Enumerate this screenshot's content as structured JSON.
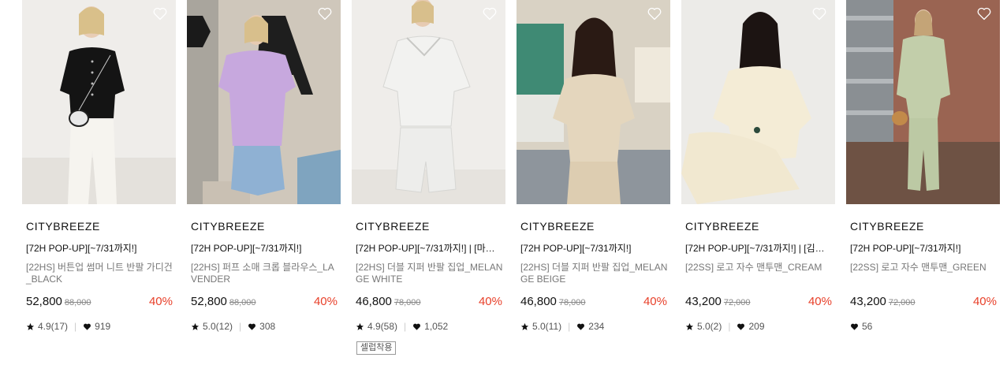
{
  "products": [
    {
      "brand": "CITYBREEZE",
      "promo": "[72H POP-UP][~7/31까지!]",
      "name": "[22HS] 버튼업 썸머 니트 반팔 가디건_BLACK",
      "price": "52,800",
      "original_price": "88,000",
      "discount": "40%",
      "rating": "4.9(17)",
      "likes": "919",
      "tag": ""
    },
    {
      "brand": "CITYBREEZE",
      "promo": "[72H POP-UP][~7/31까지!]",
      "name": "[22HS] 퍼프 소매 크롭 블라우스_LAVENDER",
      "price": "52,800",
      "original_price": "88,000",
      "discount": "40%",
      "rating": "5.0(12)",
      "likes": "308",
      "tag": ""
    },
    {
      "brand": "CITYBREEZE",
      "promo": "[72H POP-UP][~7/31까지!] | [마…",
      "name": "[22HS] 더블 지퍼 반팔 집업_MELANGE WHITE",
      "price": "46,800",
      "original_price": "78,000",
      "discount": "40%",
      "rating": "4.9(58)",
      "likes": "1,052",
      "tag": "셀럽착용"
    },
    {
      "brand": "CITYBREEZE",
      "promo": "[72H POP-UP][~7/31까지!]",
      "name": "[22HS] 더블 지퍼 반팔 집업_MELANGE BEIGE",
      "price": "46,800",
      "original_price": "78,000",
      "discount": "40%",
      "rating": "5.0(11)",
      "likes": "234",
      "tag": ""
    },
    {
      "brand": "CITYBREEZE",
      "promo": "[72H POP-UP][~7/31까지!] | [김…",
      "name": "[22SS] 로고 자수 맨투맨_CREAM",
      "price": "43,200",
      "original_price": "72,000",
      "discount": "40%",
      "rating": "5.0(2)",
      "likes": "209",
      "tag": ""
    },
    {
      "brand": "CITYBREEZE",
      "promo": "[72H POP-UP][~7/31까지!]",
      "name": "[22SS] 로고 자수 맨투맨_GREEN",
      "price": "43,200",
      "original_price": "72,000",
      "discount": "40%",
      "rating": "",
      "likes": "56",
      "tag": ""
    }
  ],
  "colors": {
    "discount": "#e8402a",
    "text": "#111111",
    "muted": "#777777"
  }
}
